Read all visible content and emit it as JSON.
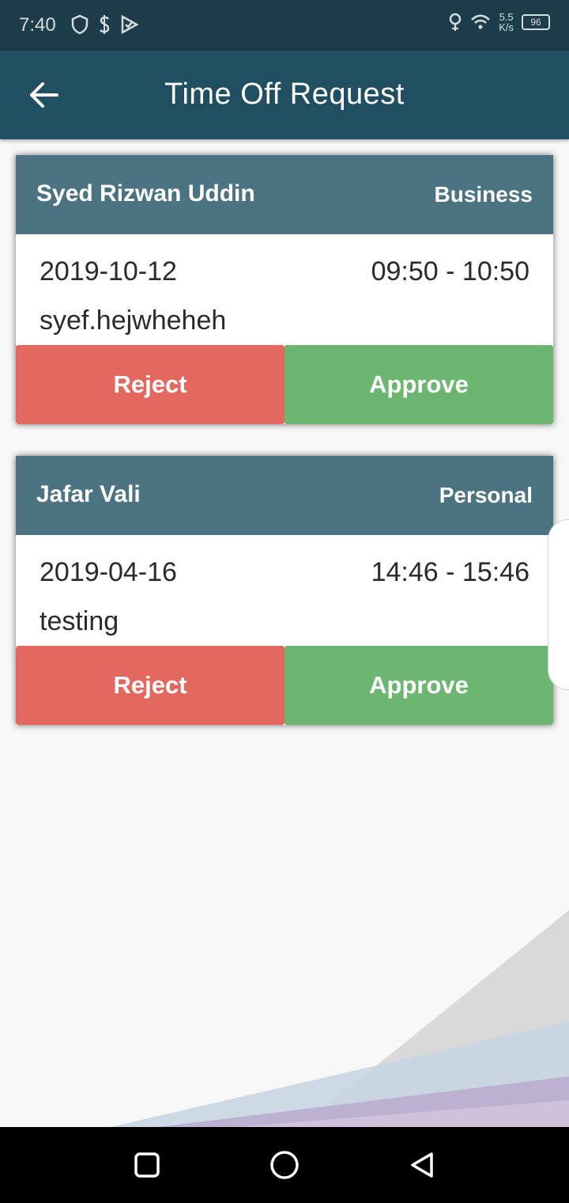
{
  "status_bar": {
    "time": "7:40",
    "net_speed_value": "5.5",
    "net_speed_unit": "K/s",
    "battery": "96"
  },
  "app_bar": {
    "title": "Time Off Request",
    "back_icon": "arrow-left-icon"
  },
  "requests": [
    {
      "name": "Syed Rizwan Uddin",
      "type": "Business",
      "date": "2019-10-12",
      "time_range": "09:50 - 10:50",
      "note": "syef.hejwheheh",
      "reject_label": "Reject",
      "approve_label": "Approve"
    },
    {
      "name": "Jafar Vali",
      "type": "Personal",
      "date": "2019-04-16",
      "time_range": "14:46 - 15:46",
      "note": "testing",
      "reject_label": "Reject",
      "approve_label": "Approve"
    }
  ],
  "colors": {
    "status_bar": "#1d3d4b",
    "app_bar": "#214f62",
    "card_header": "#4b7381",
    "reject": "#e36860",
    "approve": "#6db672"
  },
  "nav": {
    "recent_icon": "square-icon",
    "home_icon": "circle-icon",
    "back_icon": "triangle-back-icon"
  }
}
